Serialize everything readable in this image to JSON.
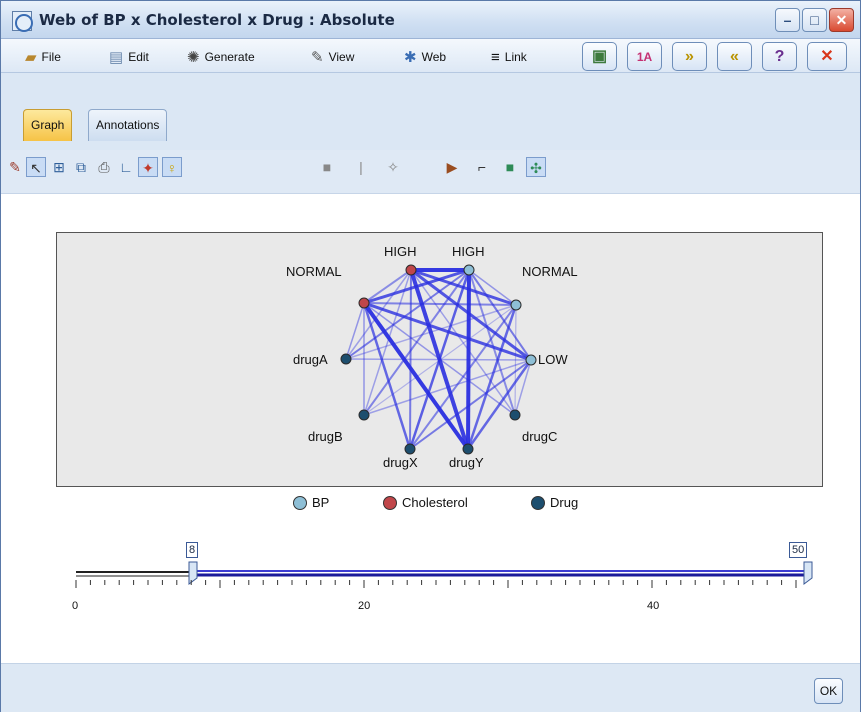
{
  "window": {
    "title": "Web of BP x Cholesterol x Drug : Absolute"
  },
  "menubar": {
    "items": [
      "File",
      "Edit",
      "Generate",
      "View",
      "Web",
      "Link"
    ]
  },
  "tabs": [
    "Graph",
    "Annotations"
  ],
  "graph": {
    "nodes": [
      {
        "name": "HIGH",
        "group": "Cholesterol"
      },
      {
        "name": "HIGH",
        "group": "BP"
      },
      {
        "name": "NORMAL",
        "group": "Cholesterol"
      },
      {
        "name": "NORMAL",
        "group": "BP"
      },
      {
        "name": "LOW",
        "group": "BP"
      },
      {
        "name": "drugA",
        "group": "Drug"
      },
      {
        "name": "drugB",
        "group": "Drug"
      },
      {
        "name": "drugC",
        "group": "Drug"
      },
      {
        "name": "drugX",
        "group": "Drug"
      },
      {
        "name": "drugY",
        "group": "Drug"
      }
    ],
    "labels": {
      "high_chol": "HIGH",
      "high_bp": "HIGH",
      "normal_chol": "NORMAL",
      "normal_bp": "NORMAL",
      "low_bp": "LOW",
      "drugA": "drugA",
      "drugB": "drugB",
      "drugC": "drugC",
      "drugX": "drugX",
      "drugY": "drugY"
    },
    "colors": {
      "BP": "#8ebfd6",
      "Cholesterol": "#c0464a",
      "Drug": "#1d4e6e",
      "link": "#2a2fe0"
    }
  },
  "legend": [
    "BP",
    "Cholesterol",
    "Drug"
  ],
  "slider": {
    "min_value": "8",
    "max_value": "50",
    "ticks": [
      "0",
      "20",
      "40"
    ]
  },
  "footer": {
    "ok_label": "OK"
  }
}
